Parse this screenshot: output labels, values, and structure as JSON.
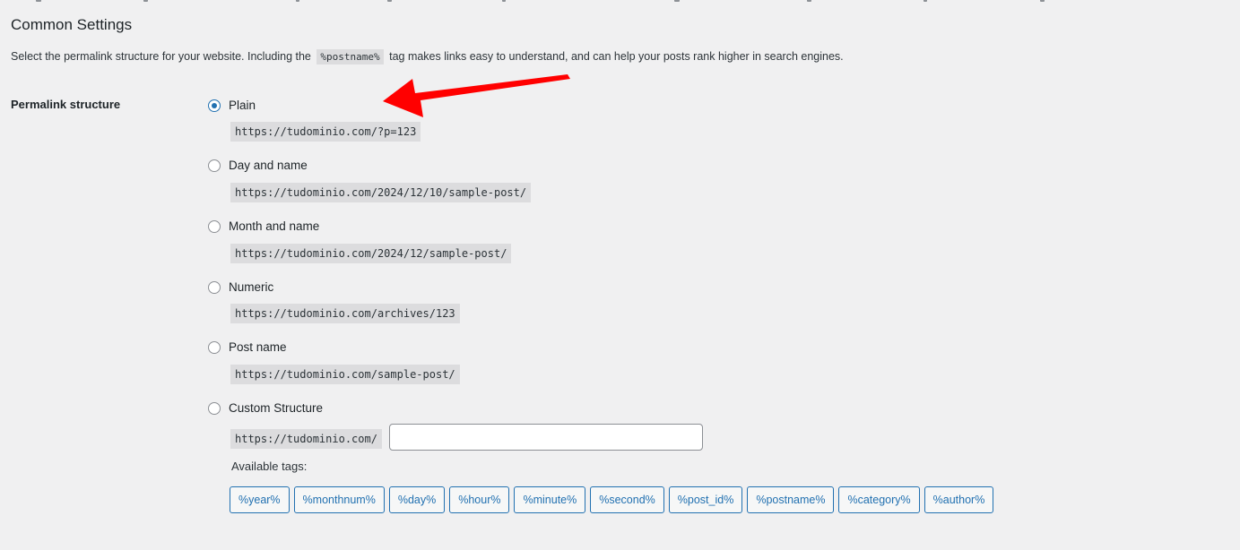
{
  "header": {
    "title": "Common Settings",
    "description_before": "Select the permalink structure for your website. Including the",
    "description_tag": "%postname%",
    "description_after": "tag makes links easy to understand, and can help your posts rank higher in search engines."
  },
  "permalink": {
    "label": "Permalink structure",
    "selected": "plain",
    "options": [
      {
        "id": "plain",
        "label": "Plain",
        "example": "https://tudominio.com/?p=123"
      },
      {
        "id": "day-and-name",
        "label": "Day and name",
        "example": "https://tudominio.com/2024/12/10/sample-post/"
      },
      {
        "id": "month-and-name",
        "label": "Month and name",
        "example": "https://tudominio.com/2024/12/sample-post/"
      },
      {
        "id": "numeric",
        "label": "Numeric",
        "example": "https://tudominio.com/archives/123"
      },
      {
        "id": "post-name",
        "label": "Post name",
        "example": "https://tudominio.com/sample-post/"
      },
      {
        "id": "custom-structure",
        "label": "Custom Structure",
        "example": "https://tudominio.com/"
      }
    ],
    "custom_value": "",
    "available_tags_label": "Available tags:",
    "tags": [
      "%year%",
      "%monthnum%",
      "%day%",
      "%hour%",
      "%minute%",
      "%second%",
      "%post_id%",
      "%postname%",
      "%category%",
      "%author%"
    ]
  },
  "colors": {
    "background": "#f0f0f1",
    "accent": "#2271b1",
    "annotation_arrow": "#ff0000"
  }
}
